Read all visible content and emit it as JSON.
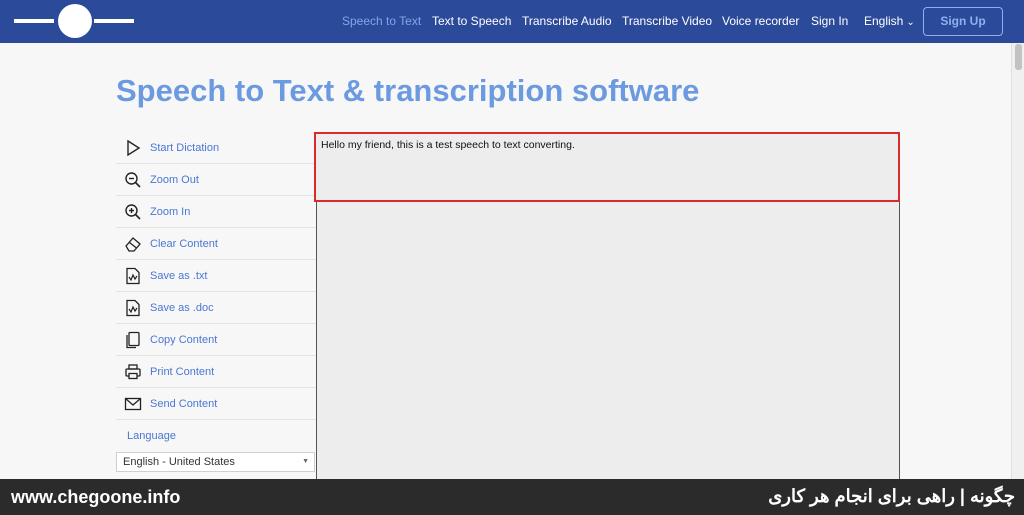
{
  "nav": {
    "items": [
      "Speech to Text",
      "Text to Speech",
      "Transcribe Audio",
      "Transcribe Video",
      "Voice recorder",
      "Sign In"
    ],
    "active": "Speech to Text",
    "language": "English",
    "signup": "Sign Up"
  },
  "page": {
    "title": "Speech to Text & transcription software"
  },
  "sidebar": {
    "items": [
      {
        "label": "Start Dictation",
        "icon": "play-icon"
      },
      {
        "label": "Zoom Out",
        "icon": "zoom-out-icon"
      },
      {
        "label": "Zoom In",
        "icon": "zoom-in-icon"
      },
      {
        "label": "Clear Content",
        "icon": "eraser-icon"
      },
      {
        "label": "Save as .txt",
        "icon": "save-txt-icon"
      },
      {
        "label": "Save as .doc",
        "icon": "save-doc-icon"
      },
      {
        "label": "Copy Content",
        "icon": "copy-icon"
      },
      {
        "label": "Print Content",
        "icon": "printer-icon"
      },
      {
        "label": "Send Content",
        "icon": "envelope-icon"
      }
    ],
    "language_label": "Language",
    "language_value": "English - United States"
  },
  "editor": {
    "text": "Hello my friend, this is a test speech to text converting."
  },
  "footer": {
    "site": "www.chegoone.info",
    "tagline": "چگونه | راهی برای انجام هر کاری"
  },
  "colors": {
    "nav_bg": "#2b4a9a",
    "accent": "#6b9ae0",
    "highlight_border": "#d92b2b"
  }
}
